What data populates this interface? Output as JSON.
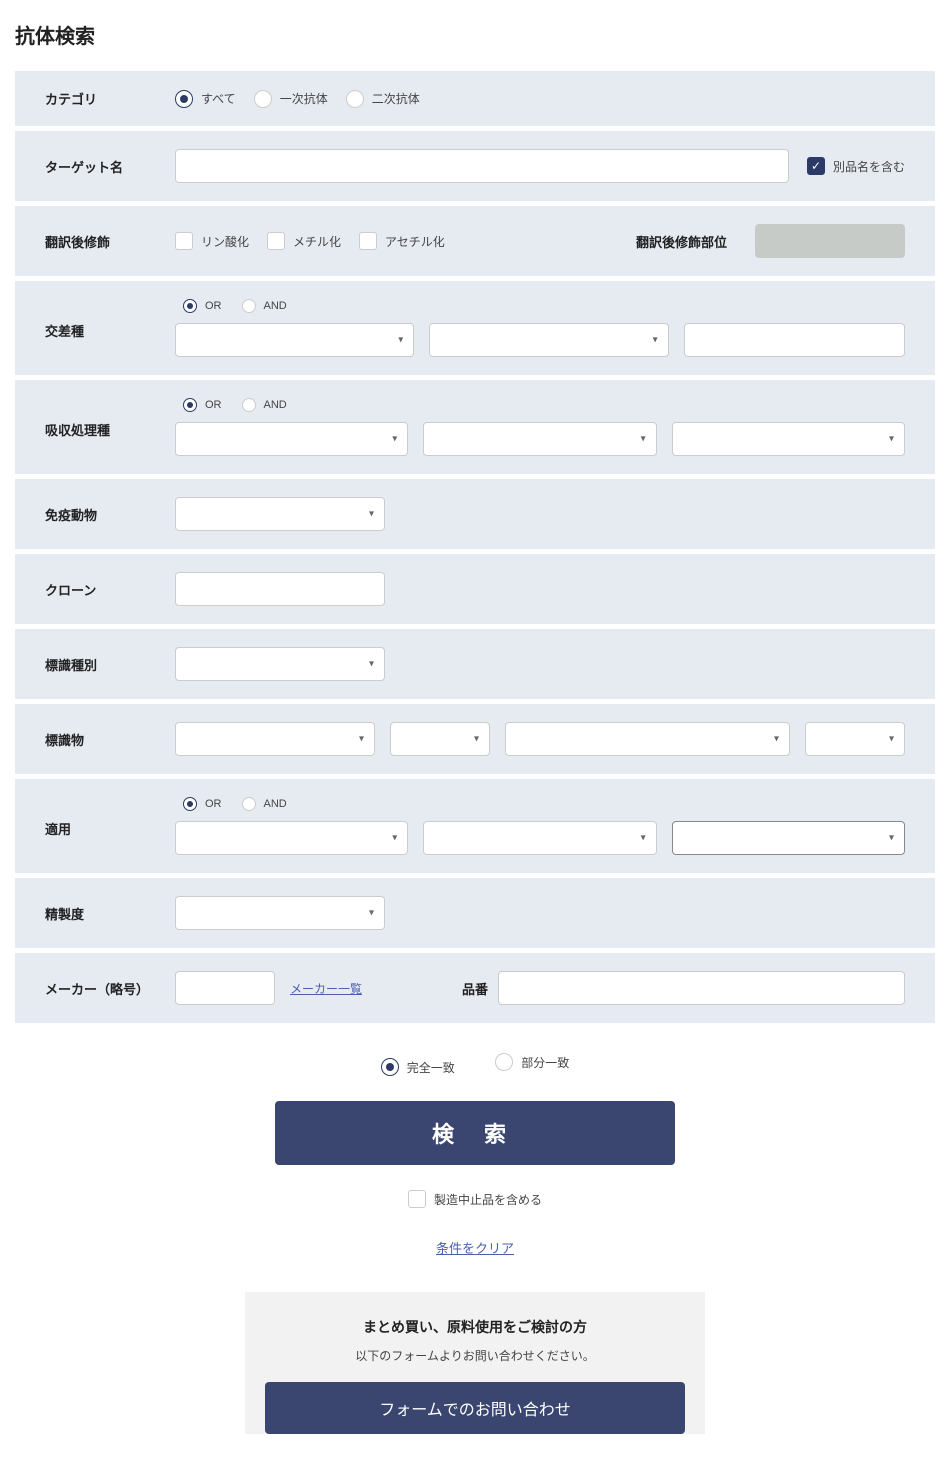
{
  "page_title": "抗体検索",
  "category": {
    "label": "カテゴリ",
    "options": {
      "all": "すべて",
      "primary": "一次抗体",
      "secondary": "二次抗体"
    },
    "selected": "all"
  },
  "target": {
    "label": "ターゲット名",
    "value": "",
    "include_alias_label": "別品名を含む",
    "include_alias_checked": true
  },
  "ptm": {
    "label": "翻訳後修飾",
    "options": {
      "phospho": "リン酸化",
      "methyl": "メチル化",
      "acetyl": "アセチル化"
    },
    "site_label": "翻訳後修飾部位"
  },
  "cross": {
    "label": "交差種",
    "logic_or": "OR",
    "logic_and": "AND",
    "selected": "or"
  },
  "absorb": {
    "label": "吸収処理種",
    "logic_or": "OR",
    "logic_and": "AND",
    "selected": "or"
  },
  "immunogen": {
    "label": "免疫動物"
  },
  "clone": {
    "label": "クローン"
  },
  "label_type": {
    "label": "標識種別"
  },
  "label_sub": {
    "label": "標識物"
  },
  "application": {
    "label": "適用",
    "logic_or": "OR",
    "logic_and": "AND",
    "selected": "or"
  },
  "purity": {
    "label": "精製度"
  },
  "maker": {
    "label": "メーカー（略号）",
    "list_link": "メーカー一覧",
    "partno_label": "品番"
  },
  "match": {
    "exact": "完全一致",
    "partial": "部分一致",
    "selected": "exact"
  },
  "search_button": "検 索",
  "discontinued_label": "製造中止品を含める",
  "clear_link": "条件をクリア",
  "inquiry": {
    "title": "まとめ買い、原料使用をご検討の方",
    "sub": "以下のフォームよりお問い合わせください。",
    "button": "フォームでのお問い合わせ"
  }
}
